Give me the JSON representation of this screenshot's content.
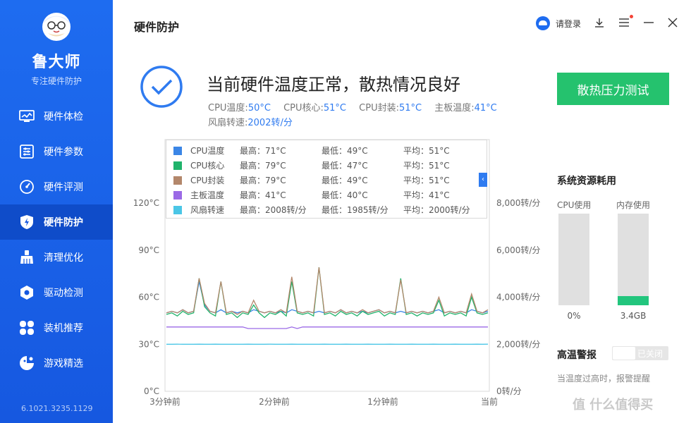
{
  "app": {
    "name": "鲁大师",
    "tagline": "专注硬件防护",
    "version": "6.1021.3235.1129"
  },
  "sidebar": {
    "items": [
      {
        "label": "硬件体检",
        "icon": "monitor-icon",
        "active": false
      },
      {
        "label": "硬件参数",
        "icon": "sliders-icon",
        "active": false
      },
      {
        "label": "硬件评测",
        "icon": "gauge-icon",
        "active": false
      },
      {
        "label": "硬件防护",
        "icon": "shield-icon",
        "active": true
      },
      {
        "label": "清理优化",
        "icon": "broom-icon",
        "active": false
      },
      {
        "label": "驱动检测",
        "icon": "driver-icon",
        "active": false
      },
      {
        "label": "装机推荐",
        "icon": "grid-icon",
        "active": false
      },
      {
        "label": "游戏精选",
        "icon": "game-icon",
        "active": false
      }
    ]
  },
  "header": {
    "title": "硬件防护",
    "login_label": "请登录"
  },
  "status": {
    "headline": "当前硬件温度正常，散热情况良好",
    "readings": [
      {
        "label": "CPU温度:",
        "value": "50°C"
      },
      {
        "label": "CPU核心:",
        "value": "51°C"
      },
      {
        "label": "CPU封装:",
        "value": "51°C"
      },
      {
        "label": "主板温度:",
        "value": "41°C"
      }
    ],
    "fan": {
      "label": "风扇转速:",
      "value": "2002转/分"
    },
    "stress_button": "散热压力测试"
  },
  "legend": [
    {
      "name": "CPU温度",
      "max": "最高：71°C",
      "min": "最低：49°C",
      "avg": "平均：51°C",
      "color": "#3b86e6"
    },
    {
      "name": "CPU核心",
      "max": "最高：79°C",
      "min": "最低：47°C",
      "avg": "平均：51°C",
      "color": "#20b36b"
    },
    {
      "name": "CPU封装",
      "max": "最高：79°C",
      "min": "最低：49°C",
      "avg": "平均：51°C",
      "color": "#b3876b"
    },
    {
      "name": "主板温度",
      "max": "最高：41°C",
      "min": "最低：40°C",
      "avg": "平均：41°C",
      "color": "#9b6ae6"
    },
    {
      "name": "风扇转速",
      "max": "最高：2008转/分",
      "min": "最低：1985转/分",
      "avg": "平均：2000转/分",
      "color": "#4bc6e6"
    }
  ],
  "chart_data": {
    "type": "line",
    "x_ticks": [
      "3分钟前",
      "2分钟前",
      "1分钟前",
      "当前"
    ],
    "y_left_ticks": [
      "0°C",
      "30°C",
      "60°C",
      "90°C",
      "120°C"
    ],
    "y_left_range": [
      0,
      120
    ],
    "y_right_ticks": [
      "0转/分",
      "2,000转/分",
      "4,000转/分",
      "6,000转/分",
      "8,000转/分"
    ],
    "y_right_range": [
      0,
      8000
    ],
    "x_range": [
      -180,
      0
    ],
    "series": [
      {
        "name": "CPU温度",
        "axis": "left",
        "color": "#3b86e6",
        "values": [
          50,
          51,
          50,
          52,
          50,
          51,
          70,
          55,
          51,
          50,
          52,
          50,
          51,
          50,
          51,
          50,
          52,
          51,
          50,
          51,
          50,
          51,
          50,
          52,
          51,
          50,
          51,
          50,
          51,
          50,
          51,
          50,
          52,
          50,
          51,
          50,
          51,
          50,
          51,
          52,
          50,
          51,
          50,
          51,
          50,
          51,
          50,
          51,
          50,
          51,
          52,
          50,
          51,
          50,
          51,
          50,
          52,
          51,
          50,
          51
        ]
      },
      {
        "name": "CPU核心",
        "axis": "left",
        "color": "#20b36b",
        "values": [
          49,
          50,
          48,
          51,
          49,
          50,
          72,
          54,
          50,
          48,
          70,
          49,
          50,
          47,
          50,
          49,
          55,
          50,
          47,
          50,
          49,
          51,
          48,
          70,
          50,
          49,
          50,
          48,
          79,
          49,
          50,
          48,
          51,
          49,
          50,
          48,
          51,
          49,
          50,
          51,
          48,
          50,
          49,
          72,
          49,
          50,
          48,
          50,
          49,
          50,
          58,
          48,
          50,
          49,
          50,
          48,
          60,
          50,
          49,
          50
        ]
      },
      {
        "name": "CPU封装",
        "axis": "left",
        "color": "#b3876b",
        "values": [
          50,
          51,
          50,
          52,
          50,
          51,
          72,
          56,
          51,
          50,
          70,
          50,
          51,
          49,
          51,
          50,
          58,
          51,
          50,
          51,
          50,
          52,
          50,
          73,
          51,
          50,
          51,
          50,
          79,
          50,
          51,
          50,
          52,
          50,
          51,
          50,
          52,
          50,
          51,
          52,
          50,
          51,
          50,
          71,
          50,
          51,
          50,
          51,
          50,
          51,
          60,
          50,
          51,
          50,
          51,
          50,
          62,
          51,
          50,
          52
        ]
      },
      {
        "name": "主板温度",
        "axis": "left",
        "color": "#9b6ae6",
        "values": [
          41,
          41,
          41,
          41,
          41,
          41,
          41,
          41,
          41,
          41,
          41,
          41,
          41,
          41,
          41,
          40,
          40,
          40,
          40,
          40,
          40,
          40,
          40,
          41,
          40,
          41,
          41,
          41,
          41,
          41,
          41,
          41,
          41,
          41,
          41,
          41,
          41,
          41,
          41,
          41,
          41,
          41,
          41,
          41,
          41,
          41,
          41,
          41,
          41,
          41,
          41,
          41,
          41,
          41,
          41,
          41,
          41,
          41,
          41,
          41
        ]
      },
      {
        "name": "风扇转速",
        "axis": "right",
        "color": "#4bc6e6",
        "values": [
          2000,
          2000,
          2001,
          2000,
          1999,
          2000,
          2002,
          2000,
          2000,
          2001,
          2000,
          2000,
          1999,
          2000,
          2000,
          2001,
          2000,
          2000,
          2000,
          2001,
          2000,
          2000,
          2000,
          2001,
          2000,
          2000,
          1999,
          2000,
          2000,
          2001,
          2000,
          2000,
          2000,
          2001,
          2000,
          2000,
          2000,
          2001,
          2000,
          2000,
          2000,
          2001,
          2000,
          2000,
          2000,
          2001,
          2000,
          2000,
          2000,
          2001,
          2000,
          2000,
          2000,
          2001,
          2000,
          2000,
          2000,
          2001,
          2000,
          2002
        ]
      }
    ]
  },
  "resources": {
    "title": "系统资源耗用",
    "cpu_label": "CPU使用",
    "cpu_value": "0%",
    "cpu_fraction": 0.0,
    "mem_label": "内存使用",
    "mem_value": "3.4GB",
    "mem_fraction": 0.1
  },
  "alarm": {
    "title": "高温警报",
    "toggle_label": "已关闭",
    "description": "当温度过高时，报警提醒"
  },
  "watermark": "值 什么值得买"
}
